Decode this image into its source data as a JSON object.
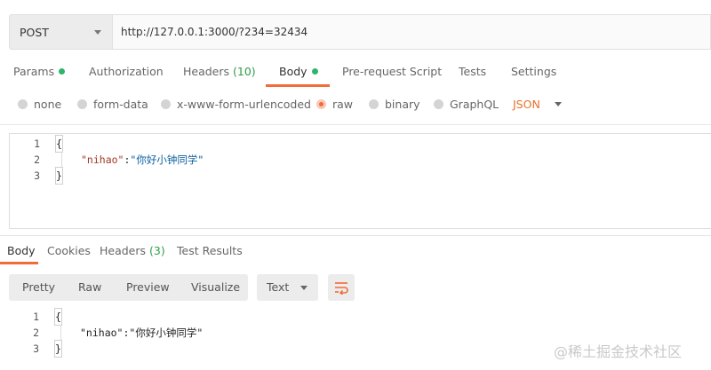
{
  "request": {
    "method": "POST",
    "url": "http://127.0.0.1:3000/?234=32434"
  },
  "tabs": [
    {
      "label": "Params",
      "dot": true
    },
    {
      "label": "Authorization"
    },
    {
      "label": "Headers",
      "count": "(10)"
    },
    {
      "label": "Body",
      "dot": true,
      "active": true
    },
    {
      "label": "Pre-request Script"
    },
    {
      "label": "Tests"
    },
    {
      "label": "Settings"
    }
  ],
  "body_types": [
    "none",
    "form-data",
    "x-www-form-urlencoded",
    "raw",
    "binary",
    "GraphQL"
  ],
  "selected_body_type": "raw",
  "raw_format": "JSON",
  "request_body": {
    "line_numbers": [
      "1",
      "2",
      "3"
    ],
    "open_brace": "{",
    "key": "\"nihao\"",
    "colon": ":",
    "value": "\"你好小钟同学\"",
    "close_brace": "}"
  },
  "response_tabs": [
    {
      "label": "Body",
      "active": true
    },
    {
      "label": "Cookies"
    },
    {
      "label": "Headers",
      "count": "(3)"
    },
    {
      "label": "Test Results"
    }
  ],
  "view_modes": [
    "Pretty",
    "Raw",
    "Preview",
    "Visualize"
  ],
  "response_format": "Text",
  "response_body": {
    "line_numbers": [
      "1",
      "2",
      "3"
    ],
    "open_brace": "{",
    "key": "\"nihao\"",
    "colon": ":",
    "value": "\"你好小钟同学\"",
    "close_brace": "}"
  },
  "watermark": "@稀土掘金技术社区",
  "colors": {
    "accent": "#f26b3a",
    "status_dot": "#2fb56a",
    "json_select": "#e8702a"
  }
}
